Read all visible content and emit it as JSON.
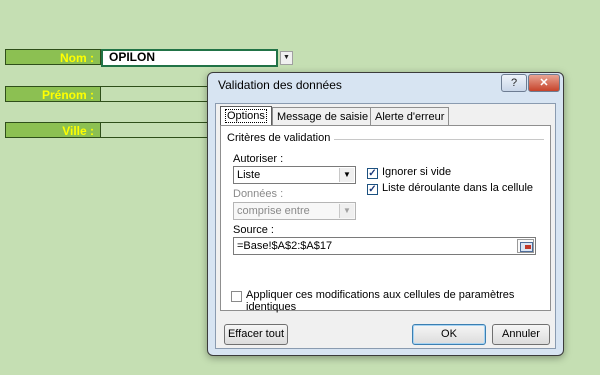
{
  "sheet": {
    "fields": [
      {
        "label": "Nom :",
        "value": "OPILON"
      },
      {
        "label": "Prénom :",
        "value": ""
      },
      {
        "label": "Ville :",
        "value": ""
      }
    ]
  },
  "dialog": {
    "title": "Validation des données",
    "help_label": "?",
    "close_label": "✕",
    "tabs": [
      "Options",
      "Message de saisie",
      "Alerte d'erreur"
    ],
    "group_title": "Critères de validation",
    "autoriser_label": "Autoriser :",
    "autoriser_value": "Liste",
    "donnees_label": "Données :",
    "donnees_value": "comprise entre",
    "ignorer_label": "Ignorer si vide",
    "ignorer_checked": true,
    "liste_label": "Liste déroulante dans la cellule",
    "liste_checked": true,
    "source_label": "Source :",
    "source_value": "=Base!$A$2:$A$17",
    "appliquer_label": "Appliquer ces modifications aux cellules de paramètres identiques",
    "appliquer_checked": false,
    "clear_button": "Effacer tout",
    "ok_button": "OK",
    "cancel_button": "Annuler"
  }
}
